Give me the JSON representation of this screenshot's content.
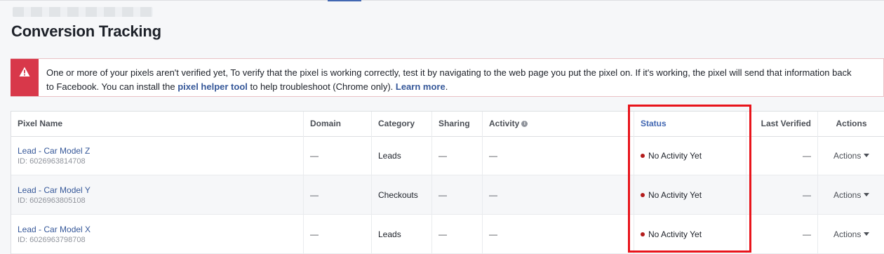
{
  "page": {
    "title": "Conversion Tracking"
  },
  "alert": {
    "text_before": "One or more of your pixels aren't verified yet, To verify that the pixel is working correctly, test it by navigating to the web page you put the pixel on. If it's working, the pixel will send that information back to Facebook. You can install the ",
    "link_text": "pixel helper tool",
    "text_middle": " to help troubleshoot (Chrome only). ",
    "learn_more": "Learn more",
    "text_after": ".",
    "icon": "warning-icon"
  },
  "table": {
    "headers": {
      "pixel_name": "Pixel Name",
      "domain": "Domain",
      "category": "Category",
      "sharing": "Sharing",
      "activity": "Activity",
      "status": "Status",
      "last_verified": "Last Verified",
      "actions": "Actions"
    },
    "rows": [
      {
        "name": "Lead - Car Model Z",
        "id": "ID: 6026963814708",
        "domain": "—",
        "category": "Leads",
        "sharing": "—",
        "activity": "—",
        "status": "No Activity Yet",
        "last_verified": "—",
        "actions": "Actions"
      },
      {
        "name": "Lead - Car Model Y",
        "id": "ID: 6026963805108",
        "domain": "—",
        "category": "Checkouts",
        "sharing": "—",
        "activity": "—",
        "status": "No Activity Yet",
        "last_verified": "—",
        "actions": "Actions"
      },
      {
        "name": "Lead - Car Model X",
        "id": "ID: 6026963798708",
        "domain": "—",
        "category": "Leads",
        "sharing": "—",
        "activity": "—",
        "status": "No Activity Yet",
        "last_verified": "—",
        "actions": "Actions"
      }
    ]
  },
  "colors": {
    "alert_red": "#d8384a",
    "link_blue": "#365899",
    "status_header_blue": "#4267b2",
    "status_dot": "#b31b1b",
    "highlight_box": "#e8141b"
  }
}
